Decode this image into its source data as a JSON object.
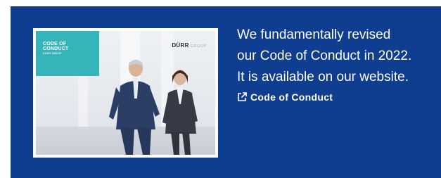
{
  "colors": {
    "panel_background": "#0f3d8f",
    "cover_accent": "#35b4b9",
    "text": "#ffffff"
  },
  "cover": {
    "title_line1": "CODE OF",
    "title_line2": "CONDUCT",
    "title_sub": "DÜRR GROUP",
    "brand": "DÜRR",
    "brand_sub": "GROUP"
  },
  "message": {
    "line1": "We fundamentally revised",
    "line2": "our Code of Conduct in 2022.",
    "line3": "It is available on our website."
  },
  "link": {
    "label": "Code of Conduct",
    "icon": "external-link-icon"
  }
}
